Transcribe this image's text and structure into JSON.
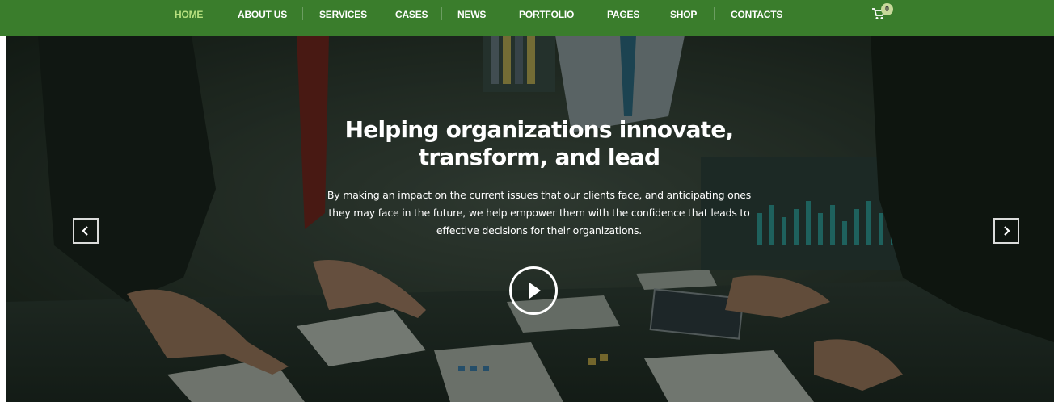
{
  "nav": {
    "items": [
      "HOME",
      "ABOUT US",
      "SERVICES",
      "CASES",
      "NEWS",
      "PORTFOLIO",
      "PAGES",
      "SHOP",
      "CONTACTS"
    ],
    "active": "HOME"
  },
  "cart": {
    "count": "0",
    "icon": "cart-icon"
  },
  "hero": {
    "headline_line1": "Helping organizations innovate,",
    "headline_line2": "transform, and lead",
    "lead": "By making an impact on the current issues that our clients face, and anticipating ones they may face in the future, we help empower them with the confidence that leads to effective decisions for their organizations.",
    "prev_icon": "chevron-left-icon",
    "next_icon": "chevron-right-icon",
    "play_icon": "play-icon"
  },
  "colors": {
    "nav_bg": "#3a7d2c",
    "nav_active": "#b7e07f",
    "text": "#ffffff"
  }
}
